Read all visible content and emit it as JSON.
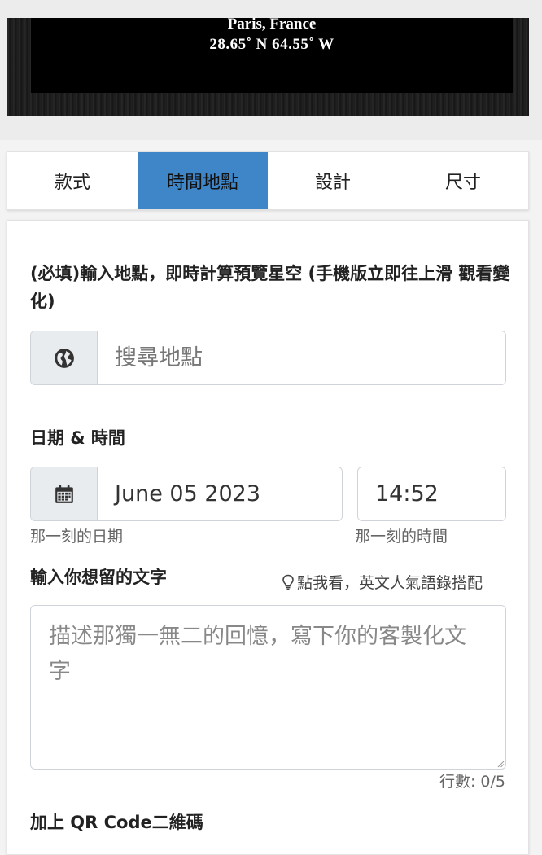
{
  "preview": {
    "place": "Paris, France",
    "coords": "28.65˚ N  64.55˚ W"
  },
  "tabs": [
    {
      "label": "款式",
      "active": false
    },
    {
      "label": "時間地點",
      "active": true
    },
    {
      "label": "設計",
      "active": false
    },
    {
      "label": "尺寸",
      "active": false
    }
  ],
  "form": {
    "location": {
      "label": "(必填)輸入地點，即時計算預覽星空 (手機版立即往上滑 觀看變化)",
      "placeholder": "搜尋地點",
      "icon": "globe-icon"
    },
    "datetime": {
      "label": "日期 & 時間",
      "date_value": "June 05 2023",
      "date_help": "那一刻的日期",
      "time_value": "14:52",
      "time_help": "那一刻的時間",
      "icon": "calendar-icon"
    },
    "text": {
      "label": "輸入你想留的文字",
      "hint": "點我看，英文人氣語錄搭配",
      "placeholder": "描述那獨一無二的回憶，寫下你的客製化文字",
      "line_count": "行數: 0/5"
    },
    "qr": {
      "label": "加上 QR Code二維碼"
    }
  },
  "colors": {
    "active_tab": "#3f86c9",
    "addon_bg": "#e9ecef"
  }
}
